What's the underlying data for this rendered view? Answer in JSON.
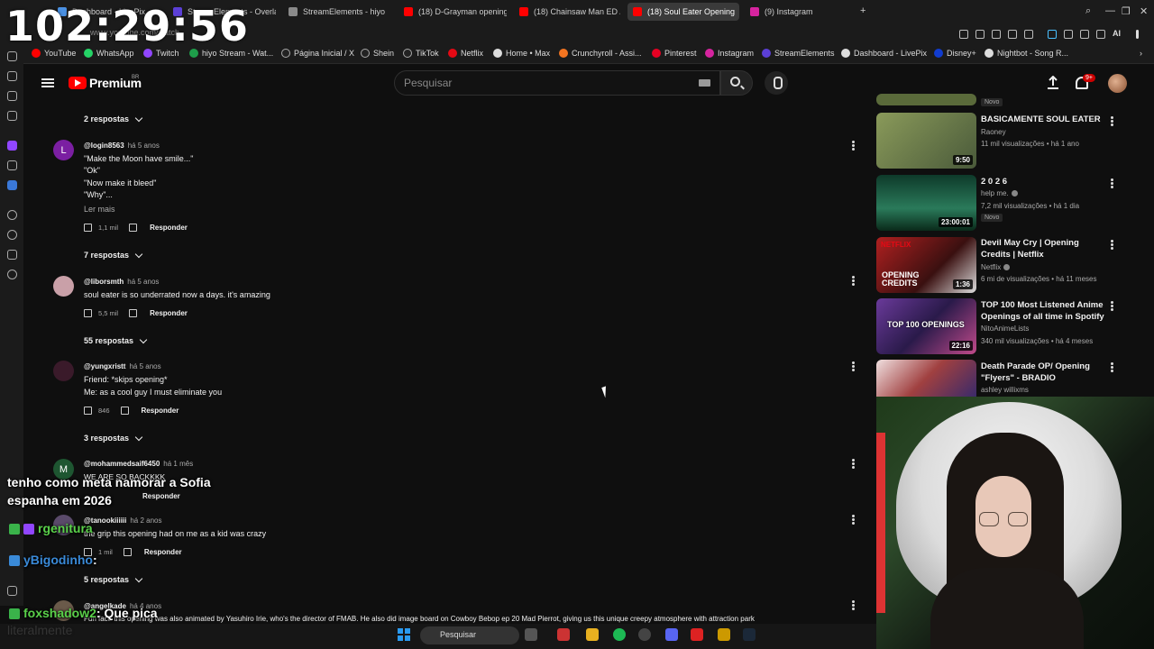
{
  "browser": {
    "tabs": [
      {
        "label": "Dashboard - LivePix",
        "color": "#4a90e2"
      },
      {
        "label": "StreamElements - Overlay",
        "color": "#5b3fd6"
      },
      {
        "label": "StreamElements - hiyo",
        "color": "#8a8a8a"
      },
      {
        "label": "(18) D-Grayman opening",
        "color": "#ff0000"
      },
      {
        "label": "(18) Chainsaw Man ED / E",
        "color": "#ff0000"
      },
      {
        "label": "(18) Soul Eater Opening",
        "color": "#ff0000"
      },
      {
        "label": "(9) Instagram",
        "color": "#d6249f"
      }
    ],
    "url": "www.youtube.com/watch",
    "bookmarks": [
      {
        "label": "YouTube",
        "color": "#ff0000"
      },
      {
        "label": "WhatsApp",
        "color": "#25d366"
      },
      {
        "label": "Twitch",
        "color": "#9146ff"
      },
      {
        "label": "hiyo Stream - Wat...",
        "color": "#1e9e4a"
      },
      {
        "label": "Página Inicial / X",
        "color": "#dddddd"
      },
      {
        "label": "Shein",
        "color": "#dddddd"
      },
      {
        "label": "TikTok",
        "color": "#dddddd"
      },
      {
        "label": "Netflix",
        "color": "#e50914"
      },
      {
        "label": "Home • Max",
        "color": "#dddddd"
      },
      {
        "label": "Crunchyroll - Assi...",
        "color": "#f47521"
      },
      {
        "label": "Pinterest",
        "color": "#e60023"
      },
      {
        "label": "Instagram",
        "color": "#d6249f"
      },
      {
        "label": "StreamElements",
        "color": "#5b3fd6"
      },
      {
        "label": "Dashboard - LivePix",
        "color": "#dddddd"
      },
      {
        "label": "Disney+",
        "color": "#113ccf"
      },
      {
        "label": "Nightbot - Song R...",
        "color": "#dddddd"
      }
    ],
    "extension_ai": "AI"
  },
  "clock": "102:29:56",
  "youtube": {
    "brand": "Premium",
    "country": "BR",
    "search_placeholder": "Pesquisar",
    "notifications_badge": "9+"
  },
  "comments": {
    "replies_top": "2 respostas",
    "items": [
      {
        "avatar_letter": "L",
        "avatar_color": "#7b1fa2",
        "author": "@login8563",
        "age": "há 5 anos",
        "lines": [
          "\"Make the Moon have smile...\"",
          "\"Ok\"",
          "\"Now make it bleed\"",
          "\"Why\"..."
        ],
        "more": "Ler mais",
        "likes": "1,1 mil",
        "reply": "Responder",
        "replies": "7 respostas"
      },
      {
        "avatar_letter": "",
        "avatar_color": "#c9a0a8",
        "author": "@liborsmth",
        "age": "há 5 anos",
        "lines": [
          "soul eater is so underrated now a days. it's amazing"
        ],
        "likes": "5,5 mil",
        "reply": "Responder",
        "replies": "55 respostas"
      },
      {
        "avatar_letter": "",
        "avatar_color": "#3a1a2a",
        "author": "@yungxristt",
        "age": "há 5 anos",
        "lines": [
          "Friend: *skips opening*",
          "Me: as a cool guy I must eliminate you"
        ],
        "likes": "846",
        "reply": "Responder",
        "replies": "3 respostas"
      },
      {
        "avatar_letter": "M",
        "avatar_color": "#1e5631",
        "author": "@mohammedsaif6450",
        "age": "há 1 mês",
        "lines": [
          "WE ARE SO BACKKKK"
        ],
        "reply": "Responder"
      },
      {
        "avatar_letter": "",
        "avatar_color": "#5a4a6a",
        "author": "@tanookiiiiii",
        "age": "há 2 anos",
        "lines": [
          "the grip this opening had on me as a kid was crazy"
        ],
        "likes": "1 mil",
        "reply": "Responder",
        "replies": "5 respostas"
      },
      {
        "avatar_letter": "",
        "avatar_color": "#6a5a4a",
        "author": "@angelkade",
        "age": "há 4 anos",
        "lines": [
          "Fun fact: this opening was also animated by Yasuhiro Irie, who's the director of FMAB. He also did image board on Cowboy Bebop ep 20 Mad Pierrot, giving us this unique creepy atmosphere with attraction park"
        ]
      }
    ]
  },
  "related": [
    {
      "badge": "Novo"
    },
    {
      "title": "BASICAMENTE SOUL EATER",
      "channel": "Raoney",
      "meta": "11 mil visualizações • há 1 ano",
      "duration": "9:50",
      "thumb": "#6a7a4a"
    },
    {
      "title": "2 0 2 6",
      "channel": "help me.",
      "verified": true,
      "meta": "7,2 mil visualizações • há 1 dia",
      "duration": "23:00:01",
      "badge": "Novo",
      "thumb": "#1e5a3e"
    },
    {
      "title": "Devil May Cry | Opening Credits | Netflix",
      "channel": "Netflix",
      "verified": true,
      "meta": "6 mi de visualizações • há 11 meses",
      "duration": "1:36",
      "thumb": "#8a2a2a",
      "overlay": "OPENING CREDITS",
      "thumb_brand": "NETFLIX"
    },
    {
      "title": "TOP 100 Most Listened Anime Openings of all time in Spotify",
      "channel": "NitoAnimeLists",
      "meta": "340 mil visualizações • há 4 meses",
      "duration": "22:16",
      "thumb": "#4a3a7a",
      "overlay": "TOP 100 OPENINGS"
    },
    {
      "title": "Death Parade OP/ Opening \"Flyers\" - BRADIO",
      "channel": "ashley willixms",
      "thumb": "#a04040"
    }
  ],
  "chat": [
    {
      "user": "",
      "text": "tenho como meta namorar a Sofia",
      "color": "#ffffff"
    },
    {
      "user": "",
      "text": "espanha em 2026",
      "color": "#ffffff"
    },
    {
      "user": "rgenitura",
      "text": "",
      "color": "#5ad14a"
    },
    {
      "user": "yBigodinho",
      "text": ":",
      "color": "#3a8ad8"
    },
    {
      "user": "foxshadow2",
      "text": ": Que pica",
      "color": "#5ad14a"
    },
    {
      "user": "",
      "text": "literalmente",
      "color": "#ffffff"
    }
  ],
  "taskbar": {
    "search": "Pesquisar"
  }
}
